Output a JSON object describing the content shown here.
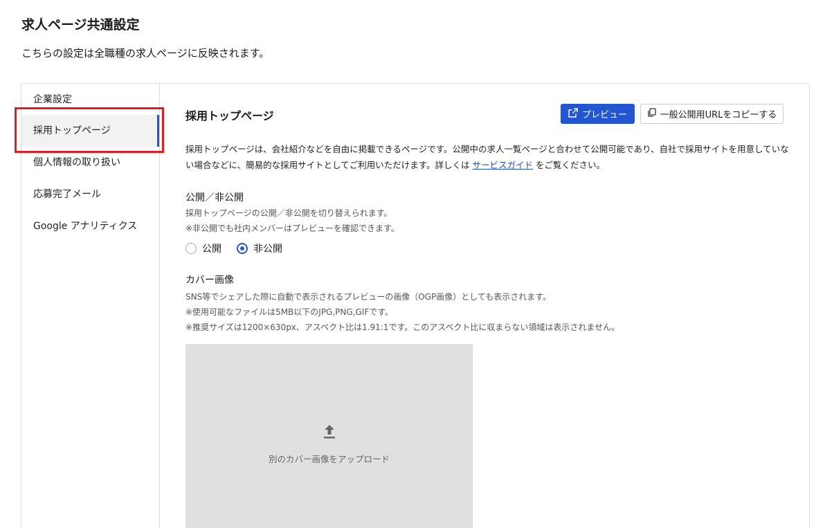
{
  "header": {
    "title": "求人ページ共通設定",
    "subtitle": "こちらの設定は全職種の求人ページに反映されます。"
  },
  "sidebar": {
    "items": [
      {
        "label": "企業設定",
        "active": false
      },
      {
        "label": "採用トップページ",
        "active": true
      },
      {
        "label": "個人情報の取り扱い",
        "active": false
      },
      {
        "label": "応募完了メール",
        "active": false
      },
      {
        "label": "Google アナリティクス",
        "active": false
      }
    ]
  },
  "main": {
    "section_title": "採用トップページ",
    "preview_button": "プレビュー",
    "copy_url_button": "一般公開用URLをコピーする",
    "description_part1": "採用トップページは、会社紹介などを自由に掲載できるページです。公開中の求人一覧ページと合わせて公開可能であり、自社で採用サイトを用意していない場合などに、簡易的な採用サイトとしてご利用いただけます。詳しくは ",
    "description_link": "サービスガイド",
    "description_part2": " をご覧ください。",
    "visibility": {
      "label": "公開／非公開",
      "hint1": "採用トップページの公開／非公開を切り替えられます。",
      "hint2": "※非公開でも社内メンバーはプレビューを確認できます。",
      "options": [
        {
          "label": "公開",
          "checked": false
        },
        {
          "label": "非公開",
          "checked": true
        }
      ]
    },
    "cover": {
      "label": "カバー画像",
      "hint1": "SNS等でシェアした際に自動で表示されるプレビューの画像（OGP画像）としても表示されます。",
      "hint2": "※使用可能なファイルは5MB以下のJPG,PNG,GIFです。",
      "hint3": "※推奨サイズは1200×630px、アスペクト比は1.91:1です。このアスペクト比に収まらない領域は表示されません。",
      "upload_text": "別のカバー画像をアップロード"
    }
  },
  "colors": {
    "accent": "#2456d3",
    "highlight": "#e01e1e"
  }
}
